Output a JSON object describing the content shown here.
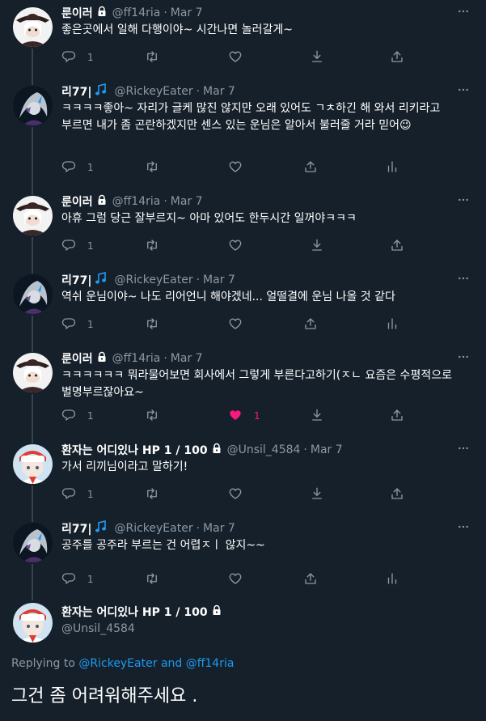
{
  "tweets": [
    {
      "display_name": "룬이러",
      "handle": "@ff14ria",
      "sep": "·",
      "date": "Mar 7",
      "text": "좋은곳에서 일해 다행이야~ 시간나면 놀러갈게~",
      "reply_count": "1",
      "avatar": "rune",
      "locked": true,
      "liked": false,
      "like_count": "",
      "has_analytics": false
    },
    {
      "display_name": "리77|",
      "handle": "@RickeyEater",
      "sep": "·",
      "date": "Mar 7",
      "text": "ㅋㅋㅋㅋ좋아~ 자리가 글케 많진 않지만 오래 있어도 ㄱㅊ하긴 해 와서 리키라고 부르면 내가 좀 곤란하겠지만 센스 있는 운님은 알아서 불러줄 거라 믿어😉",
      "reply_count": "1",
      "avatar": "rickey",
      "locked": false,
      "liked": false,
      "like_count": "",
      "has_analytics": true
    },
    {
      "display_name": "룬이러",
      "handle": "@ff14ria",
      "sep": "·",
      "date": "Mar 7",
      "text": "아휴 그럼 당근 잘부르지~ 아마 있어도 한두시간 일꺼야ㅋㅋㅋ",
      "reply_count": "1",
      "avatar": "rune",
      "locked": true,
      "liked": false,
      "like_count": "",
      "has_analytics": false
    },
    {
      "display_name": "리77|",
      "handle": "@RickeyEater",
      "sep": "·",
      "date": "Mar 7",
      "text": "역쉬 운님이야~ 나도 리어언니 해야겠네... 얼떨결에 운님 나올 것 같다",
      "reply_count": "1",
      "avatar": "rickey",
      "locked": false,
      "liked": false,
      "like_count": "",
      "has_analytics": true
    },
    {
      "display_name": "룬이러",
      "handle": "@ff14ria",
      "sep": "·",
      "date": "Mar 7",
      "text": "ㅋㅋㅋㅋㅋㅋ 뭐라물어보면 회사에서 그렇게 부른다고하기(ㅈㄴ 요즘은 수평적으로 별명부르잖아요~",
      "reply_count": "1",
      "avatar": "rune",
      "locked": true,
      "liked": true,
      "like_count": "1",
      "has_analytics": false
    },
    {
      "display_name": "환자는 어디있나 HP 1 / 100",
      "handle": "@Unsil_4584",
      "sep": "·",
      "date": "Mar 7",
      "text": "가서 리끼님이라고 말하기!",
      "reply_count": "1",
      "avatar": "unsil",
      "locked": true,
      "liked": false,
      "like_count": "",
      "has_analytics": false
    },
    {
      "display_name": "리77|",
      "handle": "@RickeyEater",
      "sep": "·",
      "date": "Mar 7",
      "text": "공주를 공주라 부르는 건 어렵ㅈㅣ 않지~~",
      "reply_count": "1",
      "avatar": "rickey",
      "locked": false,
      "liked": false,
      "like_count": "",
      "has_analytics": true
    }
  ],
  "focus": {
    "display_name": "환자는 어디있나 HP 1 / 100",
    "handle": "@Unsil_4584",
    "replying_prefix": "Replying to",
    "replying_user1": "@RickeyEater",
    "replying_and": "and",
    "replying_user2": "@ff14ria",
    "text": "그건 좀 어려워해주세요 ."
  },
  "colors": {
    "background": "#15202b",
    "muted": "#8b98a5",
    "accent": "#1d9bf0",
    "like": "#f91880",
    "thread_line": "#38444d"
  },
  "icons": {
    "reply": "reply-icon",
    "retweet": "retweet-icon",
    "like": "heart-icon",
    "download": "download-icon",
    "share": "share-icon",
    "analytics": "analytics-icon",
    "more": "more-icon",
    "lock": "lock-icon",
    "music": "music-note-icon"
  }
}
